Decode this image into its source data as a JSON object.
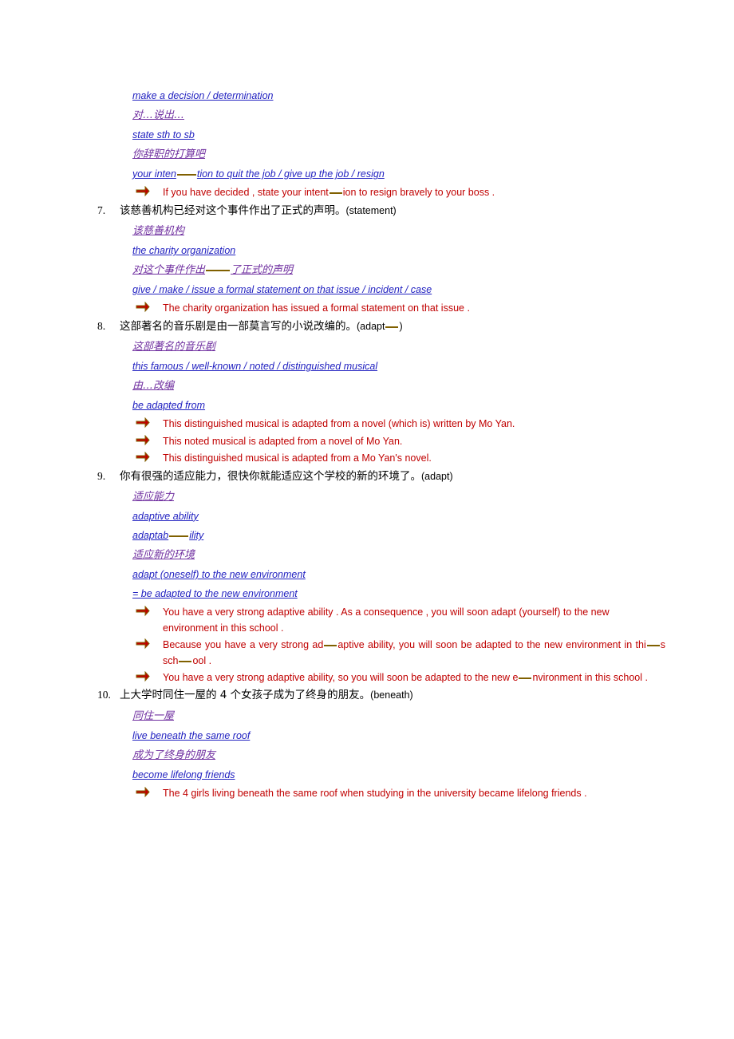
{
  "document": {
    "items": [
      {
        "id": "item-6-tail",
        "number": "",
        "chinese": "",
        "hint": "",
        "notes": [
          {
            "type": "en",
            "text": "make a decision / determination "
          },
          {
            "type": "cn",
            "text": "对…说出…"
          },
          {
            "type": "en",
            "text": "state sth to sb"
          },
          {
            "type": "cn",
            "text": "你辞职的打算吧"
          },
          {
            "type": "en_marked",
            "pre": "your inten",
            "post": "tion to quit the job / give up the job / resign"
          }
        ],
        "answers": [
          {
            "pre": "If you have decided , state your intent",
            "post": "ion to resign bravely to your boss ."
          }
        ]
      },
      {
        "id": "item-7",
        "number": "7.",
        "chinese": "该慈善机构已经对这个事件作出了正式的声明。",
        "hint": "(statement)",
        "notes": [
          {
            "type": "cn",
            "text": "该慈善机构"
          },
          {
            "type": "en",
            "text": "the charity organization"
          },
          {
            "type": "cn_marked",
            "pre": "对这个事件作出",
            "post": "了正式的声明"
          },
          {
            "type": "en",
            "text": "give / make / issue a formal statement on that issue / incident / case"
          }
        ],
        "answers": [
          {
            "text": "The charity organization has issued a formal statement on that issue ."
          }
        ]
      },
      {
        "id": "item-8",
        "number": "8.",
        "chinese": "这部著名的音乐剧是由一部莫言写的小说改编的。",
        "hint_pre": "(adapt",
        "hint_post": ")",
        "hint_marked": true,
        "notes": [
          {
            "type": "cn",
            "text": "这部著名的音乐剧"
          },
          {
            "type": "en",
            "text": "this famous / well-known / noted / distinguished musical"
          },
          {
            "type": "cn",
            "text": "由…改编"
          },
          {
            "type": "en",
            "text": "be adapted from"
          }
        ],
        "answers": [
          {
            "text": "This distinguished musical is adapted from a novel (which is) written by Mo Yan."
          },
          {
            "text": "This noted musical is adapted from a novel of Mo Yan."
          },
          {
            "text": "This distinguished musical is adapted from a Mo Yan's novel."
          }
        ]
      },
      {
        "id": "item-9",
        "number": "9.",
        "chinese": "你有很强的适应能力，很快你就能适应这个学校的新的环境了。",
        "hint": "(adapt)",
        "notes": [
          {
            "type": "cn",
            "text": "适应能力"
          },
          {
            "type": "en",
            "text": "adaptive ability"
          },
          {
            "type": "en_marked",
            "pre": "adaptab",
            "post": "ility "
          },
          {
            "type": "cn",
            "text": "适应新的环境"
          },
          {
            "type": "en",
            "text": "adapt (oneself) to the new environment "
          },
          {
            "type": "en",
            "text": "= be adapted to the new environment "
          }
        ],
        "answers": [
          {
            "text": "You have a very strong adaptive ability . As a consequence , you will soon adapt (yourself) to the new environment in this school ."
          },
          {
            "parts": [
              "Because you have a very strong ad",
              "aptive ability, you will soon be adapted to the new environment in thi",
              "s sch",
              "ool ."
            ]
          },
          {
            "parts2": [
              "You have a very strong adaptive ability, so you will soon be adapted to the new e",
              "nvironment in this school ."
            ]
          }
        ]
      },
      {
        "id": "item-10",
        "number": "10.",
        "chinese": "上大学时同住一屋的 4 个女孩子成为了终身的朋友。",
        "hint": "(beneath)",
        "notes": [
          {
            "type": "cn",
            "text": "同住一屋"
          },
          {
            "type": "en",
            "text": "live beneath the same roof"
          },
          {
            "type": "cn",
            "text": "成为了终身的朋友"
          },
          {
            "type": "en",
            "text": "become lifelong friends "
          }
        ],
        "answers": [
          {
            "text": "The 4 girls living beneath the same roof when studying in the university became lifelong friends ."
          }
        ]
      }
    ]
  },
  "colors": {
    "answer": "#c00000",
    "english_note": "#2020c0",
    "chinese_note": "#7030a0",
    "mark": "#806000"
  }
}
